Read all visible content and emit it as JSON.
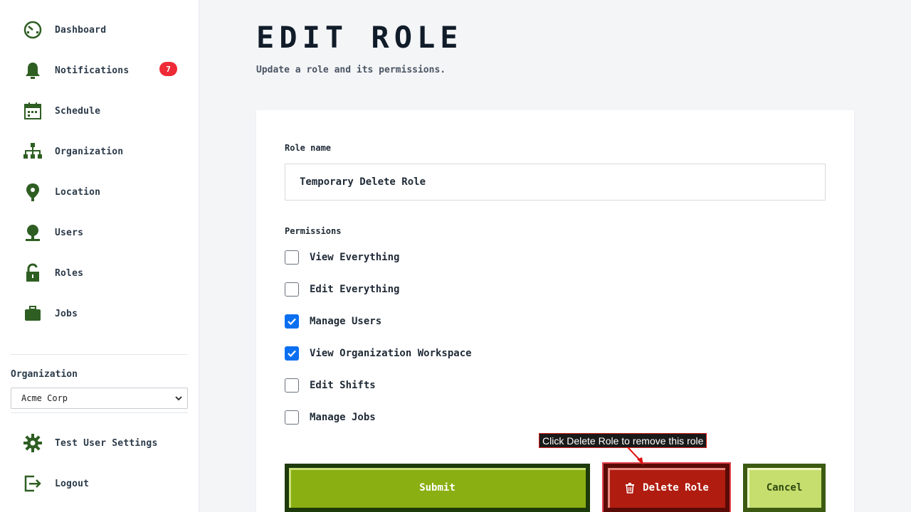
{
  "sidebar": {
    "items": [
      {
        "label": "Dashboard",
        "icon": "dashboard-icon"
      },
      {
        "label": "Notifications",
        "icon": "bell-icon",
        "badge": "7"
      },
      {
        "label": "Schedule",
        "icon": "calendar-icon"
      },
      {
        "label": "Organization",
        "icon": "org-chart-icon"
      },
      {
        "label": "Location",
        "icon": "location-pin-icon"
      },
      {
        "label": "Users",
        "icon": "user-icon"
      },
      {
        "label": "Roles",
        "icon": "lock-icon"
      },
      {
        "label": "Jobs",
        "icon": "briefcase-icon"
      }
    ],
    "organization_label": "Organization",
    "organization_selected": "Acme Corp",
    "settings_label": "Test User Settings",
    "logout_label": "Logout"
  },
  "main": {
    "title": "EDIT ROLE",
    "subtitle": "Update a role and its permissions.",
    "role_name_label": "Role name",
    "role_name_value": "Temporary Delete Role",
    "permissions_label": "Permissions",
    "permissions": [
      {
        "label": "View Everything",
        "checked": false
      },
      {
        "label": "Edit Everything",
        "checked": false
      },
      {
        "label": "Manage Users",
        "checked": true
      },
      {
        "label": "View Organization Workspace",
        "checked": true
      },
      {
        "label": "Edit Shifts",
        "checked": false
      },
      {
        "label": "Manage Jobs",
        "checked": false
      }
    ],
    "submit_label": "Submit",
    "delete_label": "Delete Role",
    "cancel_label": "Cancel"
  },
  "annotation": {
    "tooltip": "Click Delete Role to remove this role"
  },
  "colors": {
    "icon_green": "#2e5e22",
    "badge_red": "#ee2b36",
    "checkbox_blue": "#0b6ff0",
    "submit_green": "#8aaf12",
    "delete_red": "#b01c10",
    "cancel_green": "#c6de6e"
  }
}
